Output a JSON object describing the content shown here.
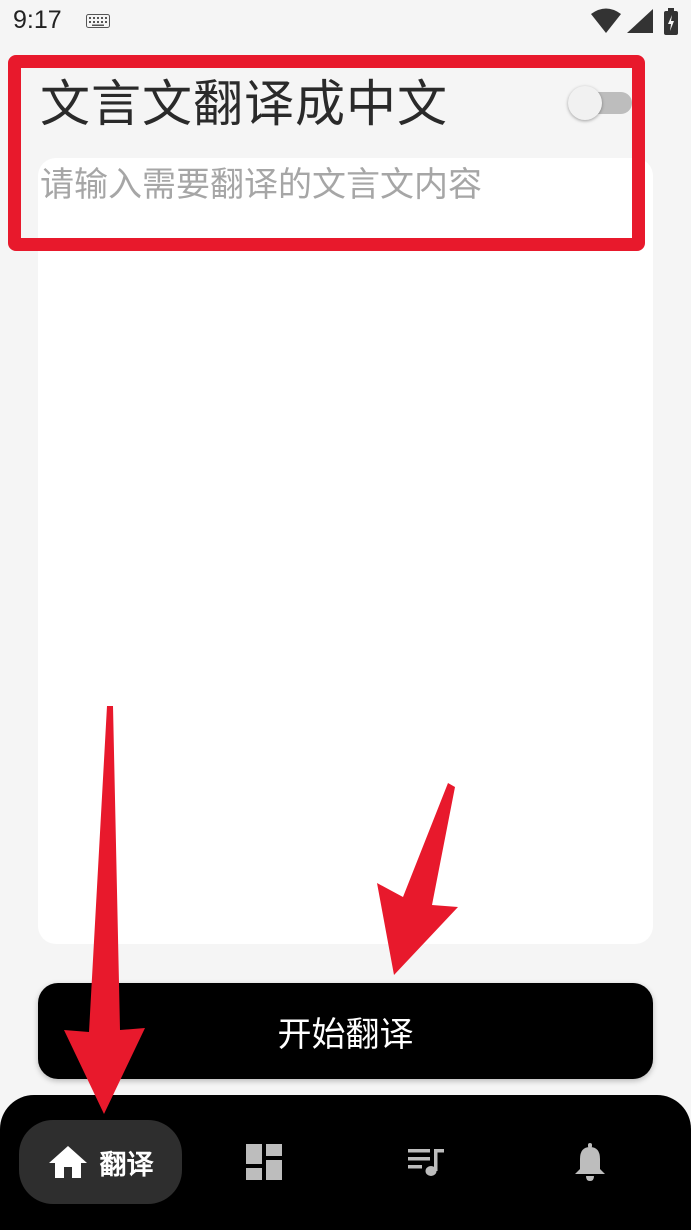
{
  "status_bar": {
    "time": "9:17",
    "icons": [
      "keyboard-icon",
      "wifi-icon",
      "signal-icon",
      "battery-icon"
    ]
  },
  "header": {
    "title": "文言文翻译成中文",
    "toggle": {
      "state": "off",
      "icon": "toggle-switch"
    }
  },
  "input": {
    "placeholder": "请输入需要翻译的文言文内容",
    "value": ""
  },
  "actions": {
    "start_label": "开始翻译"
  },
  "bottom_nav": {
    "items": [
      {
        "icon": "home-icon",
        "label": "翻译",
        "selected": true
      },
      {
        "icon": "dashboard-icon",
        "label": "",
        "selected": false
      },
      {
        "icon": "playlist-music-icon",
        "label": "",
        "selected": false
      },
      {
        "icon": "bell-icon",
        "label": "",
        "selected": false
      }
    ]
  },
  "annotations": {
    "highlight_color": "#e8192c",
    "arrow_color": "#e8192c"
  },
  "colors": {
    "background": "#f5f5f5",
    "card": "#ffffff",
    "button": "#000000",
    "nav_background": "#000000",
    "nav_selected": "#2e2e2e"
  }
}
